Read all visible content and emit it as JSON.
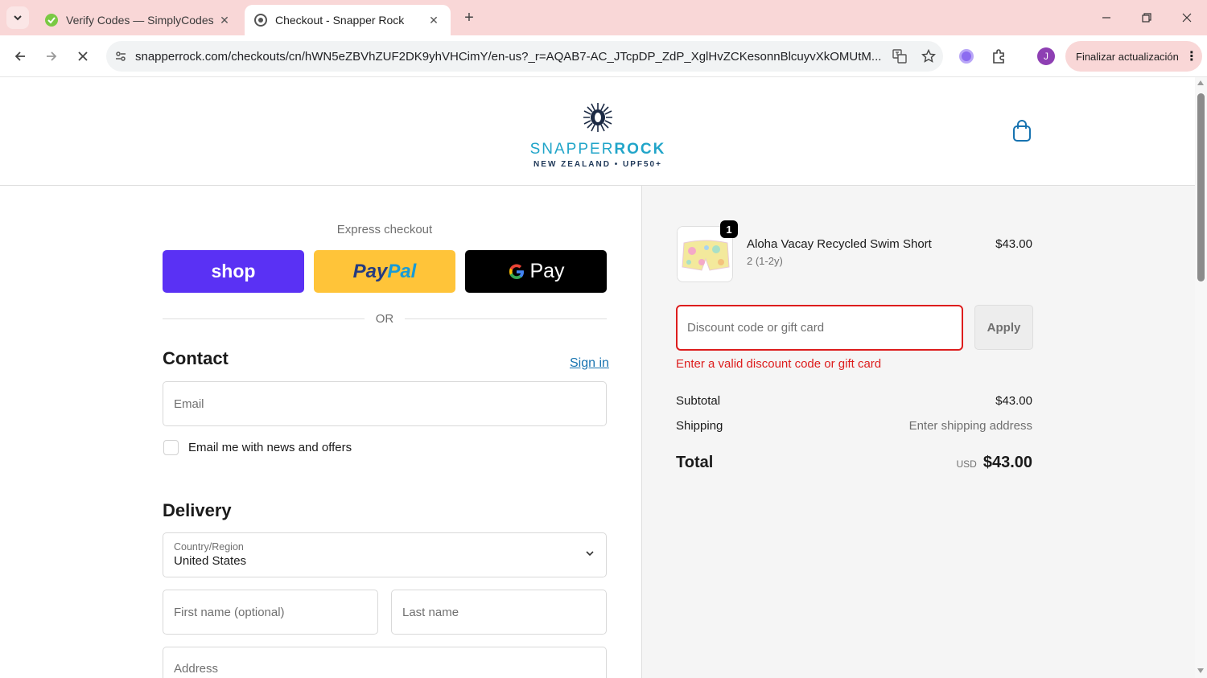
{
  "browser": {
    "tabs": [
      {
        "title": "Verify Codes — SimplyCodes",
        "active": false
      },
      {
        "title": "Checkout - Snapper Rock",
        "active": true
      }
    ],
    "url": "snapperrock.com/checkouts/cn/hWN5eZBVhZUF2DK9yhVHCimY/en-us?_r=AQAB7-AC_JTcpDP_ZdP_XglHvZCKesonnBlcuyvXkOMUtM...",
    "update_button_label": "Finalizar actualización",
    "profile_initial": "J"
  },
  "header": {
    "brand_light": "SNAPPER",
    "brand_bold": "ROCK",
    "tagline": "NEW ZEALAND • UPF50+"
  },
  "express": {
    "label": "Express checkout",
    "shop_label": "shop",
    "paypal_label_1": "Pay",
    "paypal_label_2": "Pal",
    "gpay_label": "Pay",
    "or_label": "OR"
  },
  "contact": {
    "heading": "Contact",
    "sign_in": "Sign in",
    "email_placeholder": "Email",
    "newsletter_label": "Email me with news and offers"
  },
  "delivery": {
    "heading": "Delivery",
    "country_label": "Country/Region",
    "country_value": "United States",
    "first_name_placeholder": "First name (optional)",
    "last_name_placeholder": "Last name",
    "address_placeholder": "Address"
  },
  "summary": {
    "item": {
      "quantity": "1",
      "name": "Aloha Vacay Recycled Swim Short",
      "variant": "2 (1-2y)",
      "price": "$43.00"
    },
    "discount_placeholder": "Discount code or gift card",
    "apply_label": "Apply",
    "error": "Enter a valid discount code or gift card",
    "subtotal_label": "Subtotal",
    "subtotal_value": "$43.00",
    "shipping_label": "Shipping",
    "shipping_value": "Enter shipping address",
    "total_label": "Total",
    "total_currency": "USD",
    "total_value": "$43.00"
  },
  "colors": {
    "shop": "#5a31f4",
    "paypal": "#ffc439",
    "gpay": "#000000",
    "brand": "#21a5c9",
    "error": "#dd1d1d",
    "link": "#1773b0"
  }
}
